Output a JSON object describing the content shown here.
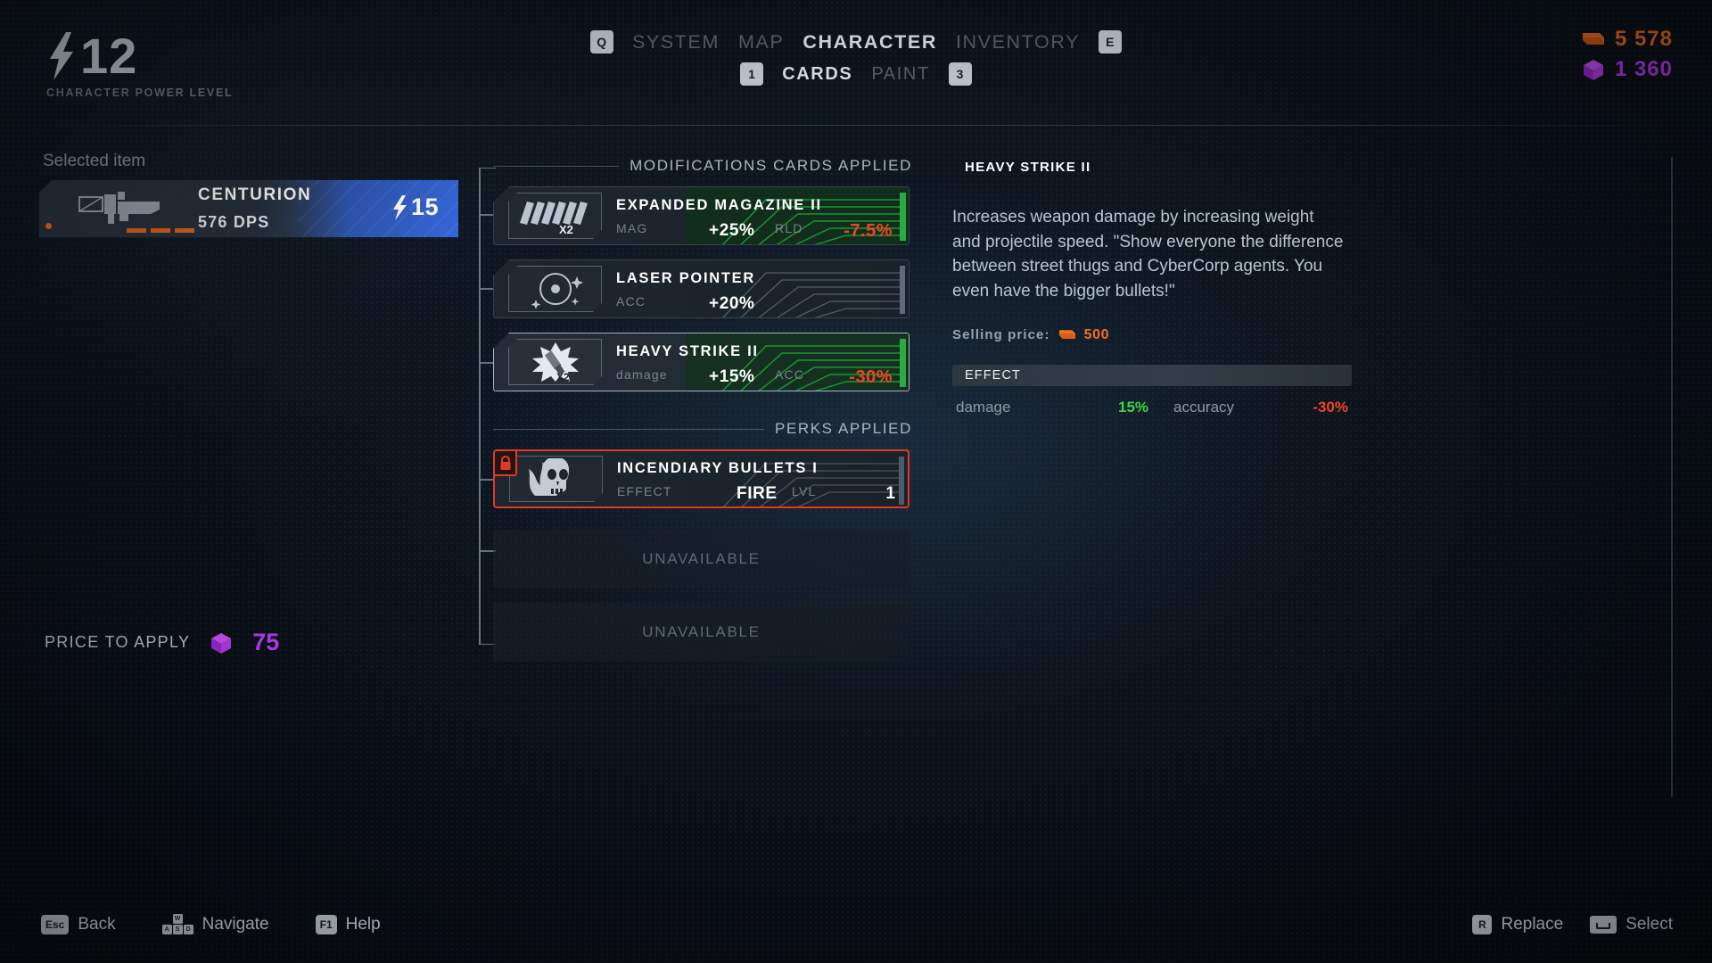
{
  "header": {
    "power_level": "12",
    "power_label": "CHARACTER POWER LEVEL",
    "main_tabs": [
      {
        "key": "Q",
        "label": "SYSTEM",
        "active": false
      },
      {
        "label": "MAP",
        "active": false
      },
      {
        "label": "CHARACTER",
        "active": true
      },
      {
        "label": "INVENTORY",
        "active": false
      },
      {
        "key": "E"
      }
    ],
    "main_keys": {
      "left": "Q",
      "right": "E"
    },
    "sub_tabs": [
      {
        "key": "1",
        "label": "CARDS",
        "active": true
      },
      {
        "label": "PAINT",
        "active": false
      },
      {
        "key": "3"
      }
    ],
    "sub_keys": {
      "left": "1",
      "right": "3"
    },
    "currency": {
      "cash_icon": "cash-icon",
      "cash_value": "5 578",
      "cash_color": "#f2701f",
      "gem_icon": "gem-icon",
      "gem_value": "1 360",
      "gem_color": "#b43cf0"
    }
  },
  "selected_item": {
    "label": "Selected item",
    "name": "CENTURION",
    "dps": "576 DPS",
    "power": "15",
    "icon": "rifle-icon"
  },
  "price_to_apply": {
    "label": "PRICE TO APPLY",
    "value": "75",
    "icon": "gem-icon"
  },
  "sections": {
    "mods_title": "MODIFICATIONS CARDS APPLIED",
    "perks_title": "PERKS APPLIED"
  },
  "mod_cards": [
    {
      "name": "EXPANDED MAGAZINE II",
      "stat_key": "MAG",
      "stat_value": "+25%",
      "stat_key2": "RLD",
      "stat_negative": "-7.5%",
      "icon": "magazine-icon",
      "multiplier": "X2",
      "trace_color": "#1f8a2e",
      "selected": false
    },
    {
      "name": "LASER POINTER",
      "stat_key": "ACC",
      "stat_value": "+20%",
      "stat_key2": "",
      "stat_negative": "",
      "icon": "laser-pointer-icon",
      "multiplier": "",
      "trace_color": "#5d6e7d",
      "selected": false
    },
    {
      "name": "HEAVY STRIKE II",
      "stat_key": "damage",
      "stat_value": "+15%",
      "stat_key2": "ACC",
      "stat_negative": "-30%",
      "icon": "heavy-strike-icon",
      "multiplier": "X2",
      "trace_color": "#1f8a2e",
      "selected": true
    }
  ],
  "perk_cards": [
    {
      "name": "INCENDIARY BULLETS I",
      "stat_key": "EFFECT",
      "stat_value": "FIRE",
      "stat_key2": "LVL",
      "level": "1",
      "icon": "flaming-skull-icon",
      "locked": true,
      "lock_color": "#e03b22"
    }
  ],
  "unavailable_slots": [
    "UNAVAILABLE",
    "UNAVAILABLE"
  ],
  "detail": {
    "title": "HEAVY STRIKE II",
    "description": "Increases weapon damage by increasing weight and projectile speed. \"Show everyone the difference between street thugs and CyberCorp agents. You even have the bigger bullets!\"",
    "selling_price_label": "Selling price:",
    "selling_price_value": "500",
    "effect_header": "EFFECT",
    "effects": [
      {
        "key": "damage",
        "value": "15%",
        "color": "#3fd24a"
      },
      {
        "key": "accuracy",
        "value": "-30%",
        "color": "#f04522"
      }
    ]
  },
  "footer": {
    "left": [
      {
        "key": "Esc",
        "label": "Back",
        "icon": "esc-key-icon"
      },
      {
        "key": "WASD",
        "label": "Navigate",
        "icon": "wasd-keys-icon"
      },
      {
        "key": "F1",
        "label": "Help",
        "icon": "f1-key-icon"
      }
    ],
    "right": [
      {
        "key": "R",
        "label": "Replace",
        "icon": "r-key-icon"
      },
      {
        "key": "Space",
        "label": "Select",
        "icon": "spacebar-icon"
      }
    ]
  }
}
